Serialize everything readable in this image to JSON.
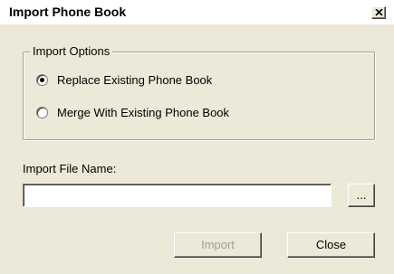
{
  "window": {
    "title": "Import Phone Book",
    "close_symbol": "×"
  },
  "import_options": {
    "legend": "Import Options",
    "options": [
      {
        "label": "Replace Existing Phone Book",
        "selected": true
      },
      {
        "label": "Merge With Existing Phone Book",
        "selected": false
      }
    ]
  },
  "file": {
    "label": "Import File Name:",
    "value": "",
    "browse_label": "..."
  },
  "buttons": {
    "import_label": "Import",
    "import_enabled": false,
    "close_label": "Close"
  },
  "icons": {
    "title_close": "close-icon",
    "radio_selected": "radio-dot-icon"
  },
  "colors": {
    "dialog_bg": "#ece9d8",
    "disabled_text": "#a0a0a0"
  }
}
